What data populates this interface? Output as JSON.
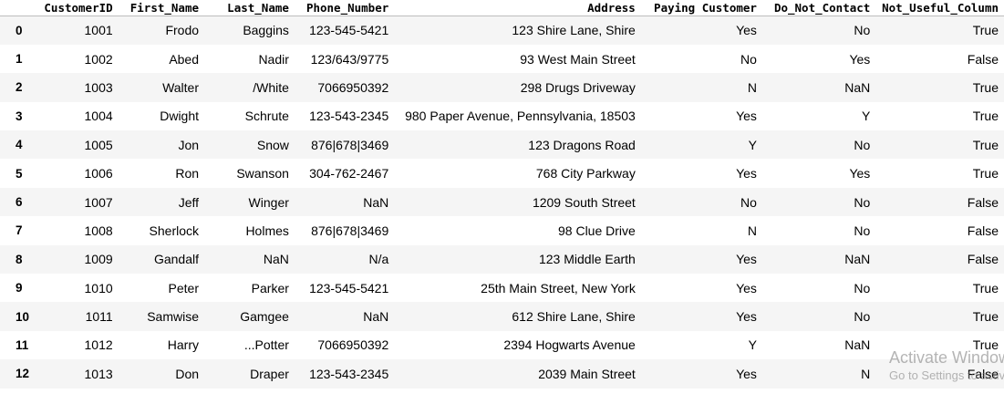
{
  "table": {
    "columns": [
      "",
      "CustomerID",
      "First_Name",
      "Last_Name",
      "Phone_Number",
      "Address",
      "Paying Customer",
      "Do_Not_Contact",
      "Not_Useful_Column"
    ],
    "rows": [
      {
        "index": "0",
        "cells": [
          "1001",
          "Frodo",
          "Baggins",
          "123-545-5421",
          "123 Shire Lane, Shire",
          "Yes",
          "No",
          "True"
        ]
      },
      {
        "index": "1",
        "cells": [
          "1002",
          "Abed",
          "Nadir",
          "123/643/9775",
          "93 West Main Street",
          "No",
          "Yes",
          "False"
        ]
      },
      {
        "index": "2",
        "cells": [
          "1003",
          "Walter",
          "/White",
          "7066950392",
          "298 Drugs Driveway",
          "N",
          "NaN",
          "True"
        ]
      },
      {
        "index": "3",
        "cells": [
          "1004",
          "Dwight",
          "Schrute",
          "123-543-2345",
          "980 Paper Avenue, Pennsylvania, 18503",
          "Yes",
          "Y",
          "True"
        ]
      },
      {
        "index": "4",
        "cells": [
          "1005",
          "Jon",
          "Snow",
          "876|678|3469",
          "123 Dragons Road",
          "Y",
          "No",
          "True"
        ]
      },
      {
        "index": "5",
        "cells": [
          "1006",
          "Ron",
          "Swanson",
          "304-762-2467",
          "768 City Parkway",
          "Yes",
          "Yes",
          "True"
        ]
      },
      {
        "index": "6",
        "cells": [
          "1007",
          "Jeff",
          "Winger",
          "NaN",
          "1209 South Street",
          "No",
          "No",
          "False"
        ]
      },
      {
        "index": "7",
        "cells": [
          "1008",
          "Sherlock",
          "Holmes",
          "876|678|3469",
          "98 Clue Drive",
          "N",
          "No",
          "False"
        ]
      },
      {
        "index": "8",
        "cells": [
          "1009",
          "Gandalf",
          "NaN",
          "N/a",
          "123 Middle Earth",
          "Yes",
          "NaN",
          "False"
        ]
      },
      {
        "index": "9",
        "cells": [
          "1010",
          "Peter",
          "Parker",
          "123-545-5421",
          "25th Main Street, New York",
          "Yes",
          "No",
          "True"
        ]
      },
      {
        "index": "10",
        "cells": [
          "1011",
          "Samwise",
          "Gamgee",
          "NaN",
          "612 Shire Lane, Shire",
          "Yes",
          "No",
          "True"
        ]
      },
      {
        "index": "11",
        "cells": [
          "1012",
          "Harry",
          "...Potter",
          "7066950392",
          "2394 Hogwarts Avenue",
          "Y",
          "NaN",
          "True"
        ]
      },
      {
        "index": "12",
        "cells": [
          "1013",
          "Don",
          "Draper",
          "123-543-2345",
          "2039 Main Street",
          "Yes",
          "N",
          "False"
        ]
      }
    ]
  },
  "watermark": {
    "title": "Activate Windows",
    "subtitle": "Go to Settings to activate Windows."
  }
}
